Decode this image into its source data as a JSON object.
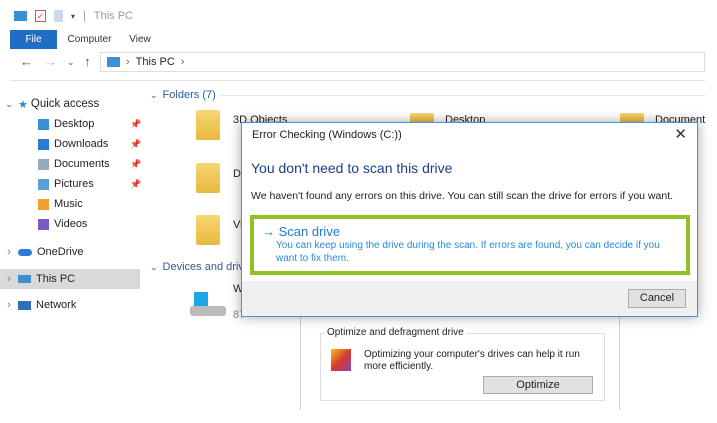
{
  "window": {
    "title": "This PC"
  },
  "ribbon": {
    "tabs": [
      "File",
      "Computer",
      "View"
    ]
  },
  "address": {
    "path": "This PC"
  },
  "sidebar": {
    "quick_access": "Quick access",
    "items": [
      {
        "label": "Desktop",
        "pinned": true
      },
      {
        "label": "Downloads",
        "pinned": true
      },
      {
        "label": "Documents",
        "pinned": true
      },
      {
        "label": "Pictures",
        "pinned": true
      },
      {
        "label": "Music",
        "pinned": false
      },
      {
        "label": "Videos",
        "pinned": false
      }
    ],
    "onedrive": "OneDrive",
    "this_pc": "This PC",
    "network": "Network"
  },
  "main": {
    "folders_header": "Folders (7)",
    "devices_header": "Devices and drives",
    "folders": [
      "3D Objects",
      "Desktop",
      "Documents",
      "D",
      "Vi"
    ],
    "drive_label": "W",
    "drive_free": "87"
  },
  "dialog": {
    "title": "Error Checking (Windows (C:))",
    "heading": "You don't need to scan this drive",
    "body": "We haven't found any errors on this drive. You can still scan the drive for errors if you want.",
    "option_title": "Scan drive",
    "option_desc": "You can keep using the drive during the scan. If errors are found, you can decide if you want to fix them.",
    "cancel": "Cancel"
  },
  "props": {
    "group": "Optimize and defragment drive",
    "text": "Optimizing your computer's drives can help it run more efficiently.",
    "button": "Optimize"
  },
  "colors": {
    "accent": "#1e6fc4",
    "highlight": "#8fc31f",
    "heading": "#1a3d8f",
    "link": "#1f7ad4"
  }
}
